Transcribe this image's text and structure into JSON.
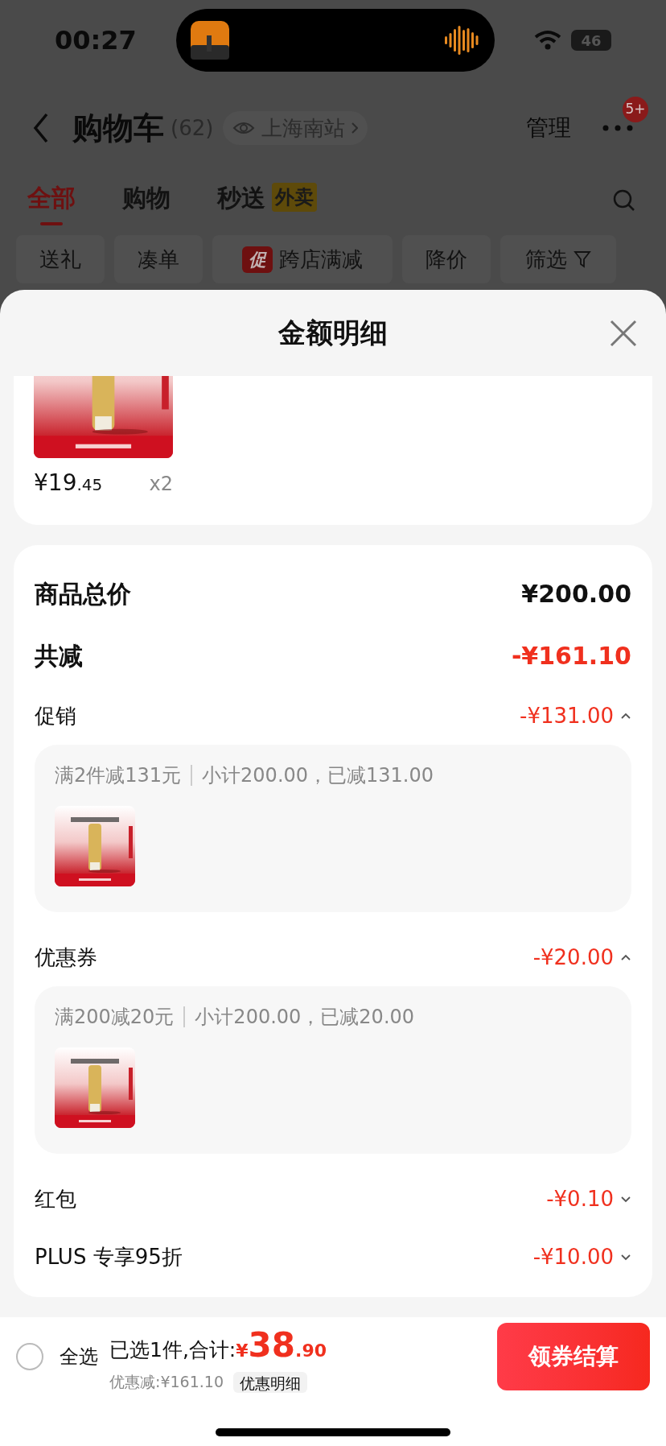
{
  "status_bar": {
    "time": "00:27",
    "battery": "46"
  },
  "header": {
    "title": "购物车",
    "count": "(62)",
    "location": "上海南站",
    "manage": "管理",
    "badge": "5+"
  },
  "tabs": [
    {
      "label": "全部",
      "selected": true
    },
    {
      "label": "购物",
      "selected": false
    },
    {
      "label": "秒送",
      "tag": "外卖",
      "selected": false
    }
  ],
  "chips": [
    {
      "label": "送礼",
      "kind": "plain"
    },
    {
      "label": "凑单",
      "kind": "plain"
    },
    {
      "label": "跨店满减",
      "tag": "促",
      "kind": "tagged"
    },
    {
      "label": "降价",
      "kind": "plain"
    },
    {
      "label": "筛选",
      "kind": "filter"
    }
  ],
  "sheet": {
    "title": "金额明细",
    "product": {
      "kind": "picture",
      "price_int": "¥19",
      "price_dec": ".45",
      "quantity": "x2"
    },
    "rows": [
      {
        "kind": "total",
        "label": "商品总价",
        "amount": "¥200.00"
      },
      {
        "kind": "reduction",
        "label": "共减",
        "amount": "-¥161.10"
      },
      {
        "kind": "discount",
        "label": "促销",
        "amount": "-¥131.00",
        "expanded": true,
        "detail": {
          "rule": "满2件减131元",
          "summary": "小计200.00，已减131.00"
        }
      },
      {
        "kind": "discount",
        "label": "优惠券",
        "amount": "-¥20.00",
        "expanded": true,
        "detail": {
          "rule": "满200减20元",
          "summary": "小计200.00，已减20.00"
        }
      },
      {
        "kind": "discount",
        "label": "红包",
        "amount": "-¥0.10",
        "expanded": false
      },
      {
        "kind": "discount",
        "label": "PLUS 专享95折",
        "amount": "-¥10.00",
        "expanded": false
      }
    ]
  },
  "bottom_bar": {
    "select_all": {
      "label": "全选",
      "checked": false
    },
    "selected_text": "已选1件,合计:",
    "currency": "¥",
    "total_int": "38",
    "total_dec": ".90",
    "saved": "优惠减:¥161.10",
    "details_button": "优惠明细",
    "checkout": "领券结算"
  }
}
